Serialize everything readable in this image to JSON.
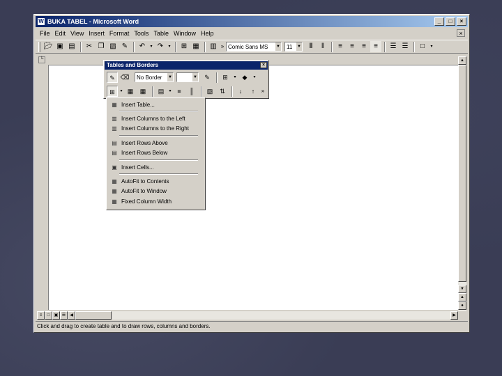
{
  "window": {
    "title": "BUKA TABEL - Microsoft Word",
    "controls": [
      "_",
      "□",
      "×"
    ]
  },
  "menubar": {
    "items": [
      "File",
      "Edit",
      "View",
      "Insert",
      "Format",
      "Tools",
      "Table",
      "Window",
      "Help"
    ],
    "close": "×"
  },
  "toolbar": {
    "font_name": "Comic Sans MS",
    "font_size": "11"
  },
  "tables_and_borders": {
    "title": "Tables and Borders",
    "close": "×",
    "border_style": "No Border"
  },
  "insert_menu": {
    "items": [
      {
        "label": "Insert Table...",
        "icon": "insert-table-icon"
      },
      {
        "sep": true
      },
      {
        "label": "Insert Columns to the Left",
        "icon": "insert-column-left-icon"
      },
      {
        "label": "Insert Columns to the Right",
        "icon": "insert-column-right-icon"
      },
      {
        "sep": true
      },
      {
        "label": "Insert Rows Above",
        "icon": "insert-row-above-icon"
      },
      {
        "label": "Insert Rows Below",
        "icon": "insert-row-below-icon"
      },
      {
        "sep": true
      },
      {
        "label": "Insert Cells...",
        "icon": "insert-cells-icon"
      },
      {
        "sep": true
      },
      {
        "label": "AutoFit to Contents",
        "icon": "autofit-contents-icon"
      },
      {
        "label": "AutoFit to Window",
        "icon": "autofit-window-icon"
      },
      {
        "label": "Fixed Column Width",
        "icon": "fixed-column-width-icon"
      }
    ]
  },
  "statusbar": {
    "text": "Click and drag to create table and to draw rows, columns and borders."
  }
}
